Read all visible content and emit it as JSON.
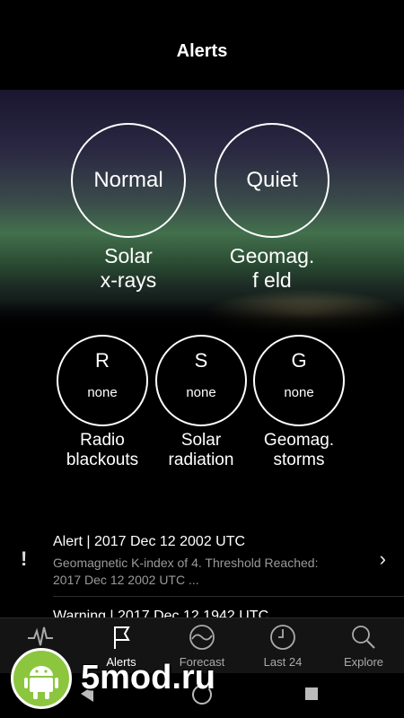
{
  "header": {
    "title": "Alerts"
  },
  "conditions": [
    {
      "status": "Normal",
      "label_line1": "Solar",
      "label_line2": "x-rays"
    },
    {
      "status": "Quiet",
      "label_line1": "Geomag.",
      "label_line2": "f eld"
    }
  ],
  "scales": [
    {
      "letter": "R",
      "value": "none",
      "label_line1": "Radio",
      "label_line2": "blackouts"
    },
    {
      "letter": "S",
      "value": "none",
      "label_line1": "Solar",
      "label_line2": "radiation"
    },
    {
      "letter": "G",
      "value": "none",
      "label_line1": "Geomag.",
      "label_line2": "storms"
    }
  ],
  "alerts": [
    {
      "title": "Alert | 2017 Dec 12 2002 UTC",
      "line1": "Geomagnetic K-index of 4. Threshold Reached:",
      "line2": "2017 Dec 12 2002 UTC ..."
    },
    {
      "title": "Warning | 2017 Dec 12 1942 UTC"
    }
  ],
  "tabs": [
    {
      "label": "",
      "icon": "pulse-icon"
    },
    {
      "label": "Alerts",
      "icon": "flag-icon",
      "active": true
    },
    {
      "label": "Forecast",
      "icon": "wave-icon"
    },
    {
      "label": "Last 24",
      "icon": "clock-icon"
    },
    {
      "label": "Explore",
      "icon": "search-icon"
    }
  ],
  "watermark": {
    "text": "5mod.ru"
  }
}
